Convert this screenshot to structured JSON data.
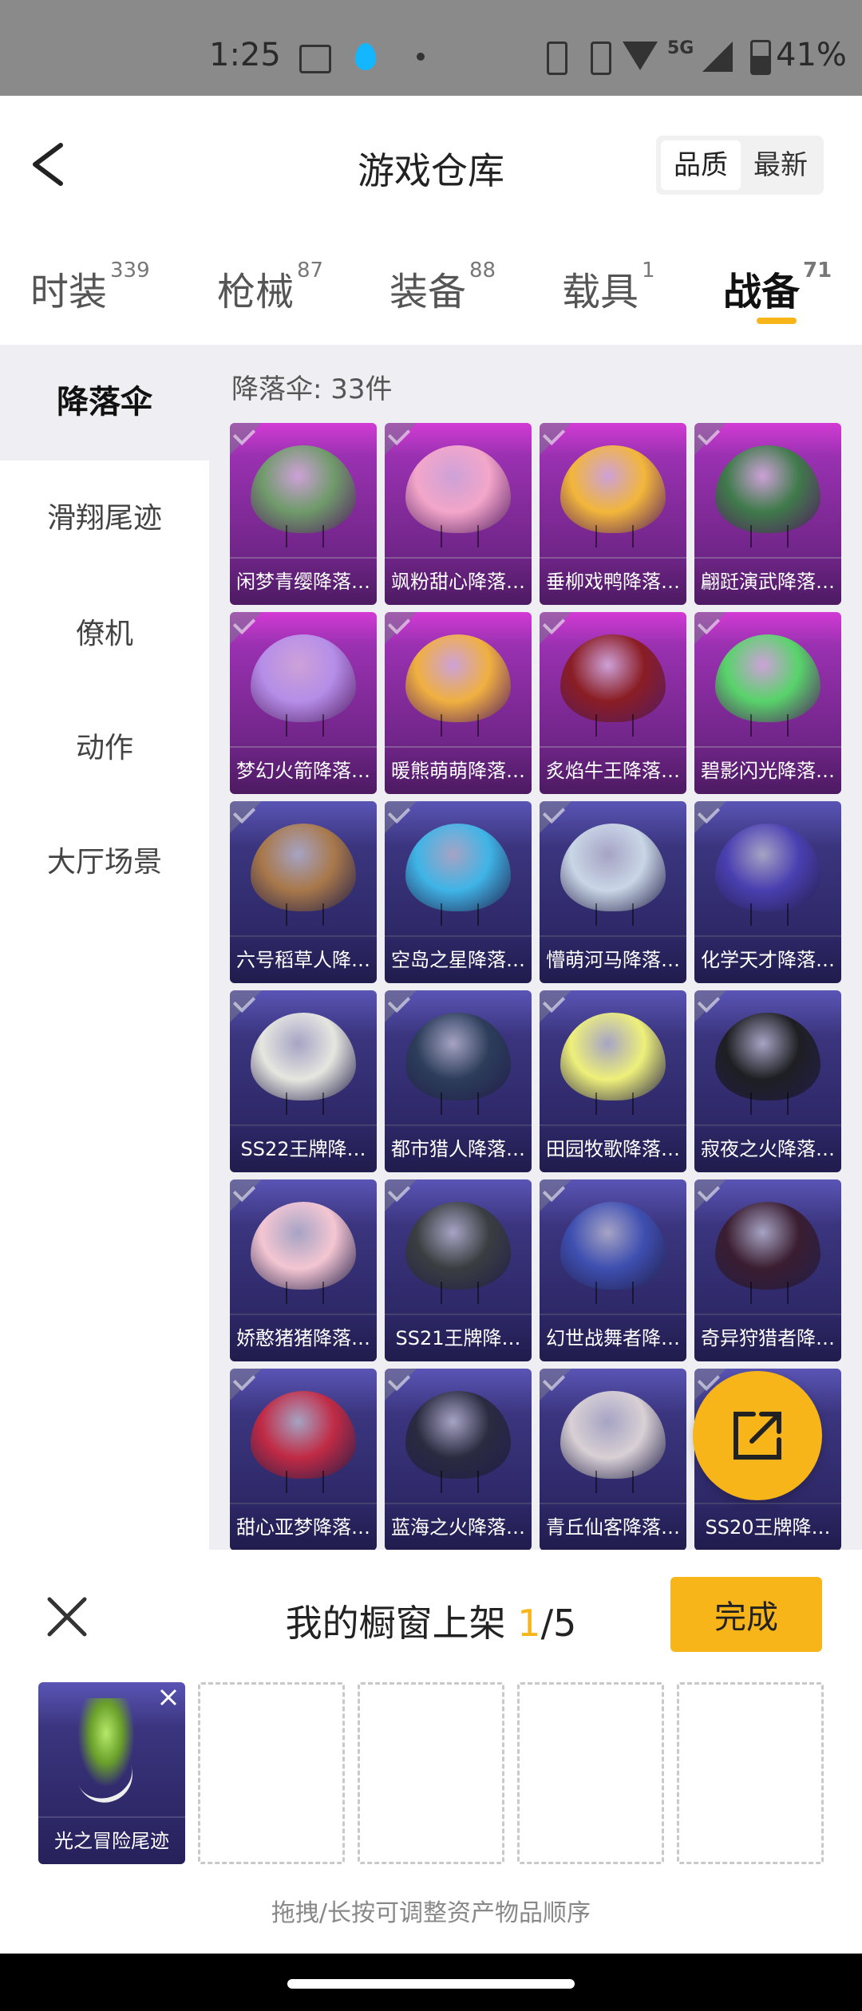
{
  "status_bar": {
    "time": "1:25",
    "network": "5G",
    "battery": "41%",
    "icons": [
      "notes-icon",
      "drop-icon",
      "dot-icon",
      "vibrate-icon",
      "nfc-icon",
      "wifi-icon",
      "signal-icon",
      "battery-icon"
    ]
  },
  "header": {
    "title": "游戏仓库",
    "sort_quality": "品质",
    "sort_newest": "最新"
  },
  "tabs": [
    {
      "label": "时装",
      "count": "339"
    },
    {
      "label": "枪械",
      "count": "87"
    },
    {
      "label": "装备",
      "count": "88"
    },
    {
      "label": "载具",
      "count": "1"
    },
    {
      "label": "战备",
      "count": "71",
      "active": true
    }
  ],
  "sidebar": {
    "items": [
      "降落伞",
      "滑翔尾迹",
      "僚机",
      "动作",
      "大厅场景"
    ]
  },
  "main": {
    "count_label": "降落伞: 33件",
    "items": [
      {
        "name": "闲梦青缨降落…",
        "rarity": "purple",
        "color": "#6f9a6a"
      },
      {
        "name": "飒粉甜心降落…",
        "rarity": "purple",
        "color": "#f3a6c9"
      },
      {
        "name": "垂柳戏鸭降落…",
        "rarity": "purple",
        "color": "#f2b63a"
      },
      {
        "name": "翩跹演武降落…",
        "rarity": "purple",
        "color": "#3f7a4a"
      },
      {
        "name": "梦幻火箭降落…",
        "rarity": "purple",
        "color": "#b58ee8"
      },
      {
        "name": "暖熊萌萌降落…",
        "rarity": "purple",
        "color": "#f0b040"
      },
      {
        "name": "炙焰牛王降落…",
        "rarity": "purple",
        "color": "#8a1d24"
      },
      {
        "name": "碧影闪光降落…",
        "rarity": "purple",
        "color": "#58d36a"
      },
      {
        "name": "六号稻草人降…",
        "rarity": "blue",
        "color": "#a8784a"
      },
      {
        "name": "空岛之星降落…",
        "rarity": "blue",
        "color": "#3fb4e6"
      },
      {
        "name": "懵萌河马降落…",
        "rarity": "blue",
        "color": "#c9d6e6"
      },
      {
        "name": "化学天才降落…",
        "rarity": "blue",
        "color": "#4a3fb0"
      },
      {
        "name": "SS22王牌降…",
        "rarity": "blue",
        "color": "#e6e6e0"
      },
      {
        "name": "都市猎人降落…",
        "rarity": "blue",
        "color": "#2c3d5a"
      },
      {
        "name": "田园牧歌降落…",
        "rarity": "blue",
        "color": "#eef07a"
      },
      {
        "name": "寂夜之火降落…",
        "rarity": "blue",
        "color": "#1e1e22"
      },
      {
        "name": "娇憨猪猪降落…",
        "rarity": "blue",
        "color": "#f4c6d2"
      },
      {
        "name": "SS21王牌降…",
        "rarity": "blue",
        "color": "#3a3e40"
      },
      {
        "name": "幻世战舞者降…",
        "rarity": "blue",
        "color": "#3e4fb0"
      },
      {
        "name": "奇异狩猎者降…",
        "rarity": "blue",
        "color": "#3a1d30"
      },
      {
        "name": "甜心亚梦降落…",
        "rarity": "blue",
        "color": "#c02a44"
      },
      {
        "name": "蓝海之火降落…",
        "rarity": "blue",
        "color": "#2a2a40"
      },
      {
        "name": "青丘仙客降落…",
        "rarity": "blue",
        "color": "#d8d0d4"
      },
      {
        "name": "SS20王牌降…",
        "rarity": "blue",
        "color": "#505060"
      }
    ]
  },
  "fab": {
    "icon": "share-external-icon"
  },
  "panel": {
    "title_prefix": "我的橱窗上架 ",
    "current": "1",
    "total": "/5",
    "done_label": "完成",
    "slots": [
      {
        "name": "光之冒险尾迹",
        "filled": true
      },
      {
        "filled": false
      },
      {
        "filled": false
      },
      {
        "filled": false
      },
      {
        "filled": false
      }
    ],
    "hint": "拖拽/长按可调整资产物品顺序"
  },
  "colors": {
    "accent": "#f7b51a",
    "purple_card": "#9a31b1",
    "blue_card": "#3b357f"
  }
}
